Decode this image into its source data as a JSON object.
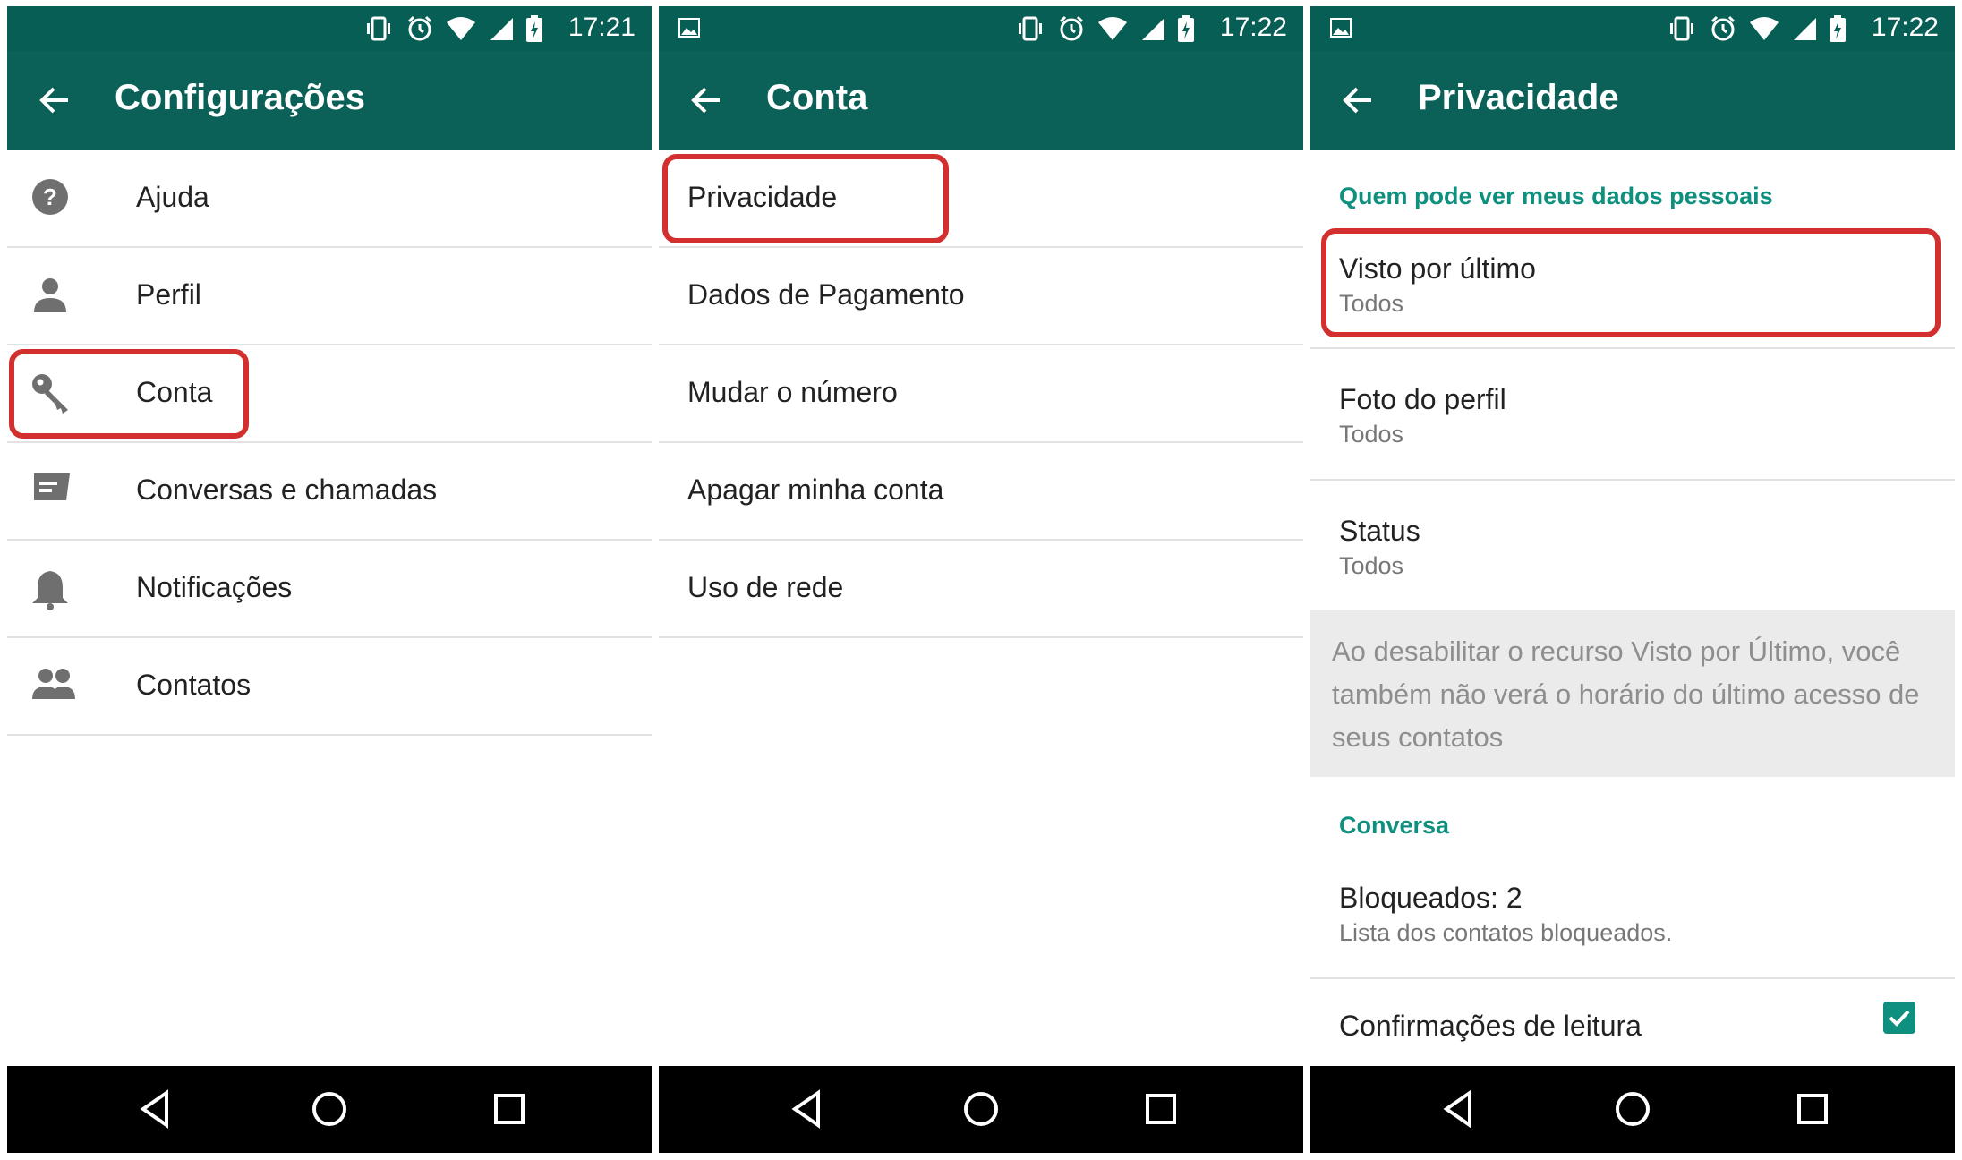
{
  "colors": {
    "statusbar": "#075e54",
    "appbar": "#0b6157",
    "accent": "#0f8f7e",
    "highlight": "#d32f2f"
  },
  "status_icons": [
    "vibrate-icon",
    "alarm-icon",
    "wifi-icon",
    "signal-icon",
    "battery-charging-icon"
  ],
  "navbar": {
    "buttons": [
      "back-triangle-icon",
      "home-circle-icon",
      "recents-square-icon"
    ]
  },
  "panels": [
    {
      "time": "17:21",
      "title": "Configurações",
      "items": [
        {
          "label": "Ajuda",
          "icon": "help-icon"
        },
        {
          "label": "Perfil",
          "icon": "person-icon"
        },
        {
          "label": "Conta",
          "icon": "key-icon",
          "highlighted": true
        },
        {
          "label": "Conversas e chamadas",
          "icon": "chat-icon"
        },
        {
          "label": "Notificações",
          "icon": "bell-icon"
        },
        {
          "label": "Contatos",
          "icon": "contacts-icon"
        }
      ]
    },
    {
      "time": "17:22",
      "title": "Conta",
      "items": [
        {
          "label": "Privacidade",
          "highlighted": true
        },
        {
          "label": "Dados de Pagamento"
        },
        {
          "label": "Mudar o número"
        },
        {
          "label": "Apagar minha conta"
        },
        {
          "label": "Uso de rede"
        }
      ]
    },
    {
      "time": "17:22",
      "title": "Privacidade",
      "section1": "Quem pode ver meus dados pessoais",
      "items": [
        {
          "title": "Visto por último",
          "subtitle": "Todos",
          "highlighted": true
        },
        {
          "title": "Foto do perfil",
          "subtitle": "Todos"
        },
        {
          "title": "Status",
          "subtitle": "Todos"
        }
      ],
      "note": "Ao desabilitar o recurso Visto por Último, você também não verá o horário do último acesso de seus contatos",
      "section2": "Conversa",
      "blocked": {
        "title": "Bloqueados: 2",
        "subtitle": "Lista dos contatos bloqueados."
      },
      "read_receipts": {
        "title": "Confirmações de leitura",
        "checked": true
      }
    }
  ]
}
